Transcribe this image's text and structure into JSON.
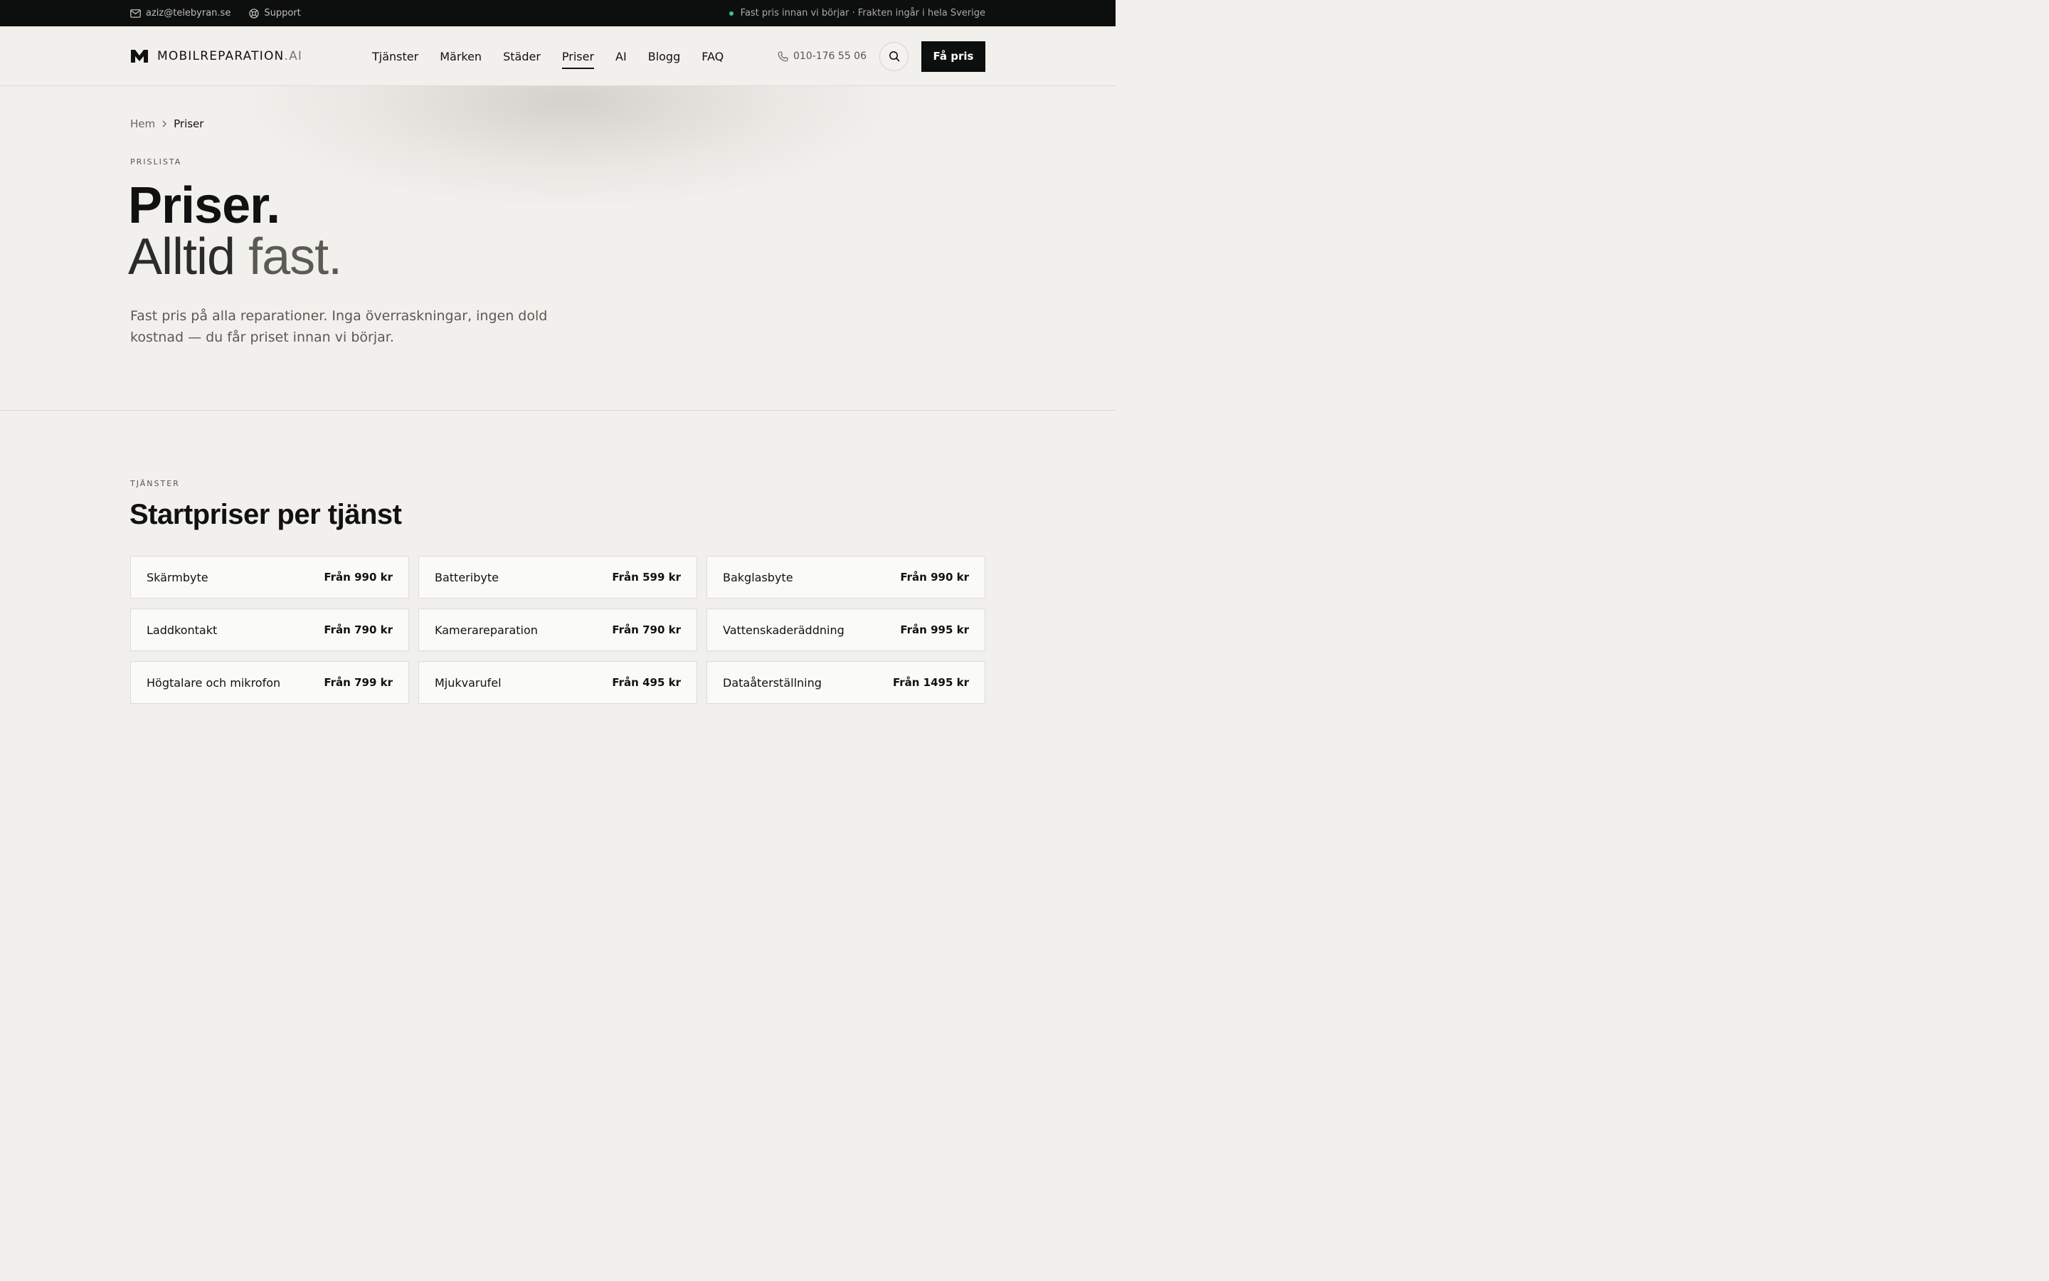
{
  "topbar": {
    "email": "aziz@telebyran.se",
    "support": "Support",
    "notice": "Fast pris innan vi börjar · Frakten ingår i hela Sverige"
  },
  "header": {
    "logo_main": "MOBILREPARATION",
    "logo_suffix": ".AI",
    "nav": [
      "Tjänster",
      "Märken",
      "Städer",
      "Priser",
      "AI",
      "Blogg",
      "FAQ"
    ],
    "active_nav": "Priser",
    "phone": "010-176 55 06",
    "cta": "Få pris"
  },
  "breadcrumb": {
    "home": "Hem",
    "current": "Priser"
  },
  "hero": {
    "eyebrow": "PRISLISTA",
    "title_line1": "Priser.",
    "title_line2_a": "Alltid",
    "title_line2_b": "fast.",
    "description": "Fast pris på alla reparationer. Inga överraskningar, ingen dold kostnad — du får priset innan vi börjar."
  },
  "services": {
    "eyebrow": "TJÄNSTER",
    "title": "Startpriser per tjänst",
    "items": [
      {
        "name": "Skärmbyte",
        "price": "Från 990 kr"
      },
      {
        "name": "Batteribyte",
        "price": "Från 599 kr"
      },
      {
        "name": "Bakglasbyte",
        "price": "Från 990 kr"
      },
      {
        "name": "Laddkontakt",
        "price": "Från 790 kr"
      },
      {
        "name": "Kamerareparation",
        "price": "Från 790 kr"
      },
      {
        "name": "Vattenskaderäddning",
        "price": "Från 995 kr"
      },
      {
        "name": "Högtalare och mikrofon",
        "price": "Från 799 kr"
      },
      {
        "name": "Mjukvarufel",
        "price": "Från 495 kr"
      },
      {
        "name": "Dataåterställning",
        "price": "Från 1495 kr"
      }
    ]
  },
  "colors": {
    "background": "#f1f0ec",
    "dark": "#0d0f0e",
    "status_dot": "#36c48a"
  }
}
